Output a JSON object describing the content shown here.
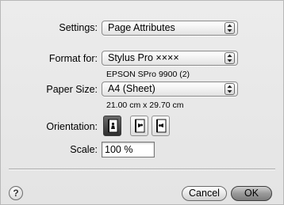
{
  "settings": {
    "label": "Settings:",
    "value": "Page Attributes"
  },
  "format_for": {
    "label": "Format for:",
    "value": "Stylus Pro ××××",
    "printer_description": "EPSON SPro 9900 (2)"
  },
  "paper_size": {
    "label": "Paper Size:",
    "value": "A4 (Sheet)",
    "dimensions": "21.00 cm x 29.70 cm"
  },
  "orientation": {
    "label": "Orientation:",
    "options": [
      "portrait",
      "landscape",
      "landscape-reversed"
    ],
    "selected": "portrait"
  },
  "scale": {
    "label": "Scale:",
    "value": "100 %"
  },
  "buttons": {
    "help": "?",
    "cancel": "Cancel",
    "ok": "OK"
  }
}
